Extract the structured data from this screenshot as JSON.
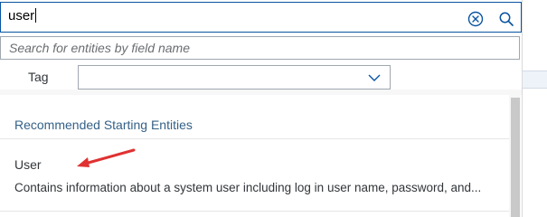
{
  "search": {
    "value": "user",
    "clear_icon": "clear-circle-icon",
    "search_icon": "magnifier-icon"
  },
  "field_search": {
    "placeholder": "Search for entities by field name"
  },
  "filter": {
    "tag_label": "Tag",
    "tag_value": "",
    "dropdown_icon": "chevron-down-icon"
  },
  "recommended": {
    "heading": "Recommended Starting Entities",
    "items": [
      {
        "title": "User",
        "description": "Contains information about a system user including log in user name, password, and..."
      }
    ]
  },
  "colors": {
    "heading": "#346187",
    "focus_border": "#0854a0",
    "annotation_arrow": "#e03131"
  }
}
